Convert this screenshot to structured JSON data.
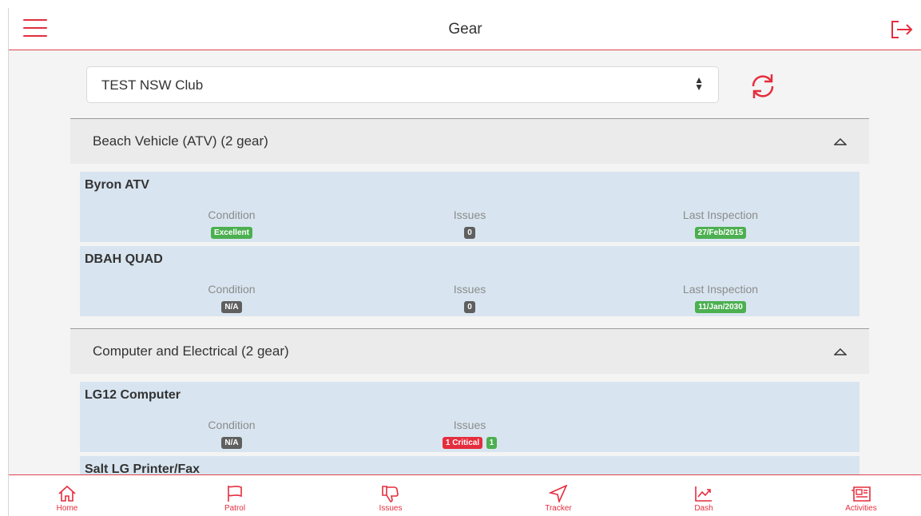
{
  "header": {
    "title": "Gear"
  },
  "club_select": {
    "value": "TEST NSW Club"
  },
  "groups": [
    {
      "title": "Beach Vehicle (ATV) (2 gear)",
      "items": [
        {
          "name": "Byron ATV",
          "condition_label": "Condition",
          "condition": "Excellent",
          "issues_label": "Issues",
          "issues": "0",
          "inspection_label": "Last Inspection",
          "inspection": "27/Feb/2015"
        },
        {
          "name": "DBAH QUAD",
          "condition_label": "Condition",
          "condition": "N/A",
          "issues_label": "Issues",
          "issues": "0",
          "inspection_label": "Last Inspection",
          "inspection": "11/Jan/2030"
        }
      ]
    },
    {
      "title": "Computer and Electrical (2 gear)",
      "items": [
        {
          "name": "LG12 Computer",
          "condition_label": "Condition",
          "condition": "N/A",
          "issues_label": "Issues",
          "issues_critical": "1 Critical",
          "issues_other": "1"
        },
        {
          "name": "Salt LG Printer/Fax"
        }
      ]
    }
  ],
  "nav": [
    {
      "label": "Home",
      "icon": "home-icon"
    },
    {
      "label": "Patrol",
      "icon": "flag-icon"
    },
    {
      "label": "Issues",
      "icon": "thumbs-down-icon"
    },
    {
      "label": "Tracker",
      "icon": "navigation-arrow-icon"
    },
    {
      "label": "Dash",
      "icon": "chart-icon"
    },
    {
      "label": "Activities",
      "icon": "newspaper-icon"
    }
  ],
  "colors": {
    "accent": "#e52d3d",
    "card": "#d8e5f0",
    "badge_green": "#4caf50",
    "badge_gray": "#5f5f5f"
  }
}
